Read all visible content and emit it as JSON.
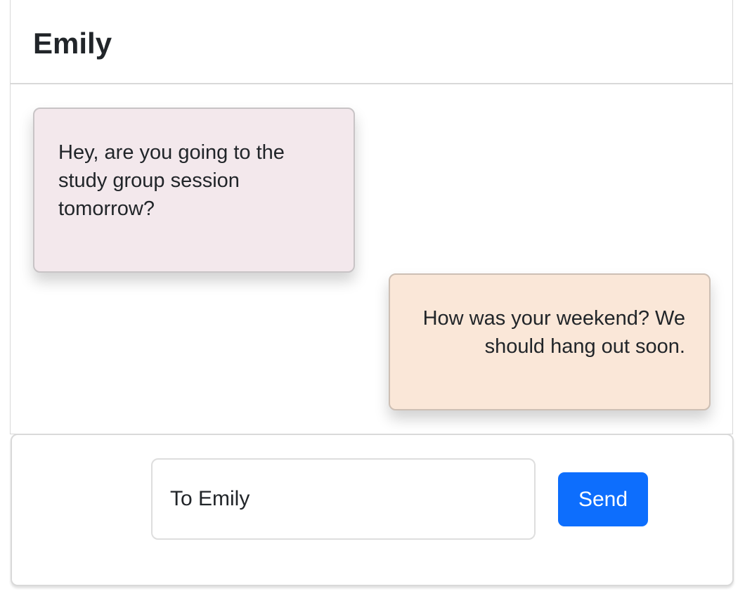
{
  "conversation": {
    "contact_name": "Emily"
  },
  "messages": [
    {
      "direction": "incoming",
      "text": "Hey, are you going to the study group session tomorrow?"
    },
    {
      "direction": "outgoing",
      "text": "How was your weekend? We should hang out soon."
    }
  ],
  "composer": {
    "input_value": "To Emily",
    "send_label": "Send"
  },
  "colors": {
    "incoming_bubble": "#f3e8ec",
    "outgoing_bubble": "#fae7d8",
    "send_button": "#0d6efd"
  }
}
